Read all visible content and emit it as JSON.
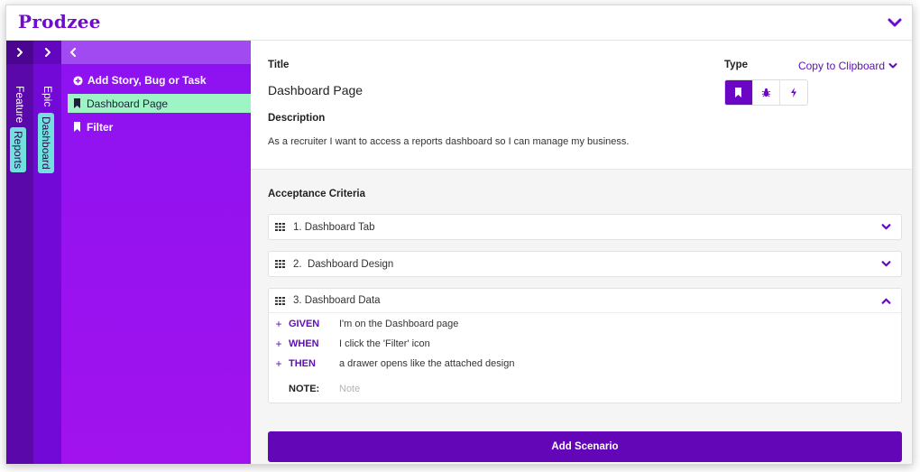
{
  "app": {
    "logo": "Prodzee"
  },
  "rails": {
    "feature": {
      "label": "Feature",
      "badge": "Reports"
    },
    "epic": {
      "label": "Epic",
      "badge": "Dashboard"
    }
  },
  "sidebar": {
    "add_label": "Add Story, Bug or Task",
    "items": [
      {
        "label": "Dashboard Page",
        "active": true
      },
      {
        "label": "Filter",
        "active": false
      }
    ]
  },
  "detail": {
    "title_label": "Title",
    "title_value": "Dashboard Page",
    "description_label": "Description",
    "description_value": "As a recruiter I want to access a reports dashboard so I can manage my business.",
    "type_label": "Type",
    "copy_label": "Copy to Clipboard",
    "type_options": [
      "story-bookmark-icon",
      "bug-icon",
      "task-bolt-icon"
    ],
    "type_selected": "story-bookmark-icon"
  },
  "criteria": {
    "title": "Acceptance Criteria",
    "items": [
      {
        "label": "1. Dashboard Tab",
        "expanded": false
      },
      {
        "label": "2.  Dashboard Design",
        "expanded": false
      },
      {
        "label": "3. Dashboard Data",
        "expanded": true,
        "steps": [
          {
            "keyword": "GIVEN",
            "text": "I'm on the Dashboard page"
          },
          {
            "keyword": "WHEN",
            "text": "I click the 'Filter' icon"
          },
          {
            "keyword": "THEN",
            "text": "a drawer opens like the attached design"
          }
        ],
        "note_label": "NOTE:",
        "note_placeholder": "Note"
      }
    ],
    "add_button": "Add Scenario"
  },
  "colors": {
    "brand": "#6f0bd0",
    "active_item": "#9ef4c5",
    "badge": "#72e0dd",
    "button": "#6306b8"
  }
}
